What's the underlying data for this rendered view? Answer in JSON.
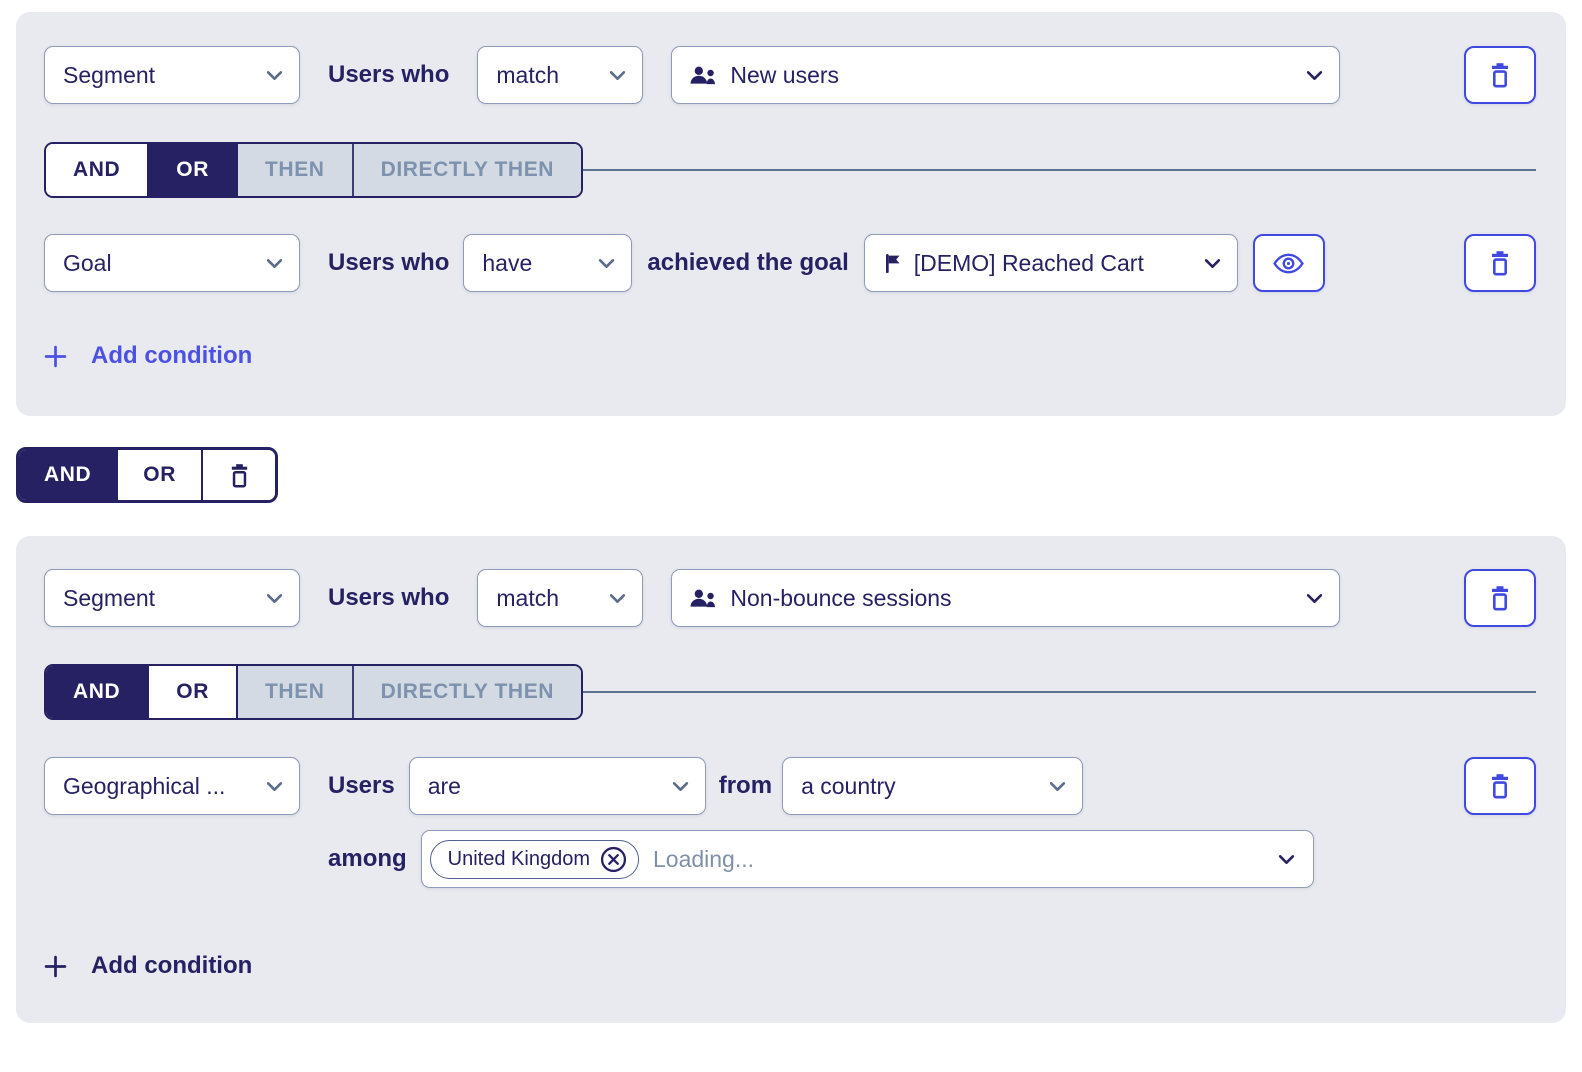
{
  "colors": {
    "navy": "#262163",
    "accent_blue": "#4049e0",
    "link_blue": "#4d51e1",
    "panel_background": "#e8eaef",
    "muted_toggle_text": "#7d92ae",
    "muted_toggle_background": "#d4dae3"
  },
  "group1": {
    "condition1": {
      "type": "Segment",
      "subject_label": "Users who",
      "operator": "match",
      "value": "New users",
      "value_icon": "users-group-icon"
    },
    "logic_toggle": {
      "and": "AND",
      "or": "OR",
      "then": "THEN",
      "directly_then": "DIRECTLY THEN",
      "selected": "OR"
    },
    "condition2": {
      "type": "Goal",
      "subject_label": "Users who",
      "operator": "have",
      "connector_label": "achieved the goal",
      "value": "[DEMO] Reached Cart",
      "value_icon": "flag-icon"
    },
    "add_condition": "Add condition"
  },
  "group_joiner": {
    "and": "AND",
    "or": "OR",
    "selected": "AND"
  },
  "group2": {
    "condition1": {
      "type": "Segment",
      "subject_label": "Users who",
      "operator": "match",
      "value": "Non-bounce sessions",
      "value_icon": "users-group-icon"
    },
    "logic_toggle": {
      "and": "AND",
      "or": "OR",
      "then": "THEN",
      "directly_then": "DIRECTLY THEN",
      "selected": "AND"
    },
    "condition2": {
      "type": "Geographical ...",
      "subject_label": "Users",
      "operator": "are",
      "connector_label": "from",
      "value": "a country"
    },
    "among": {
      "label": "among",
      "selected_chip": "United Kingdom",
      "status_text": "Loading..."
    },
    "add_condition": "Add condition"
  }
}
